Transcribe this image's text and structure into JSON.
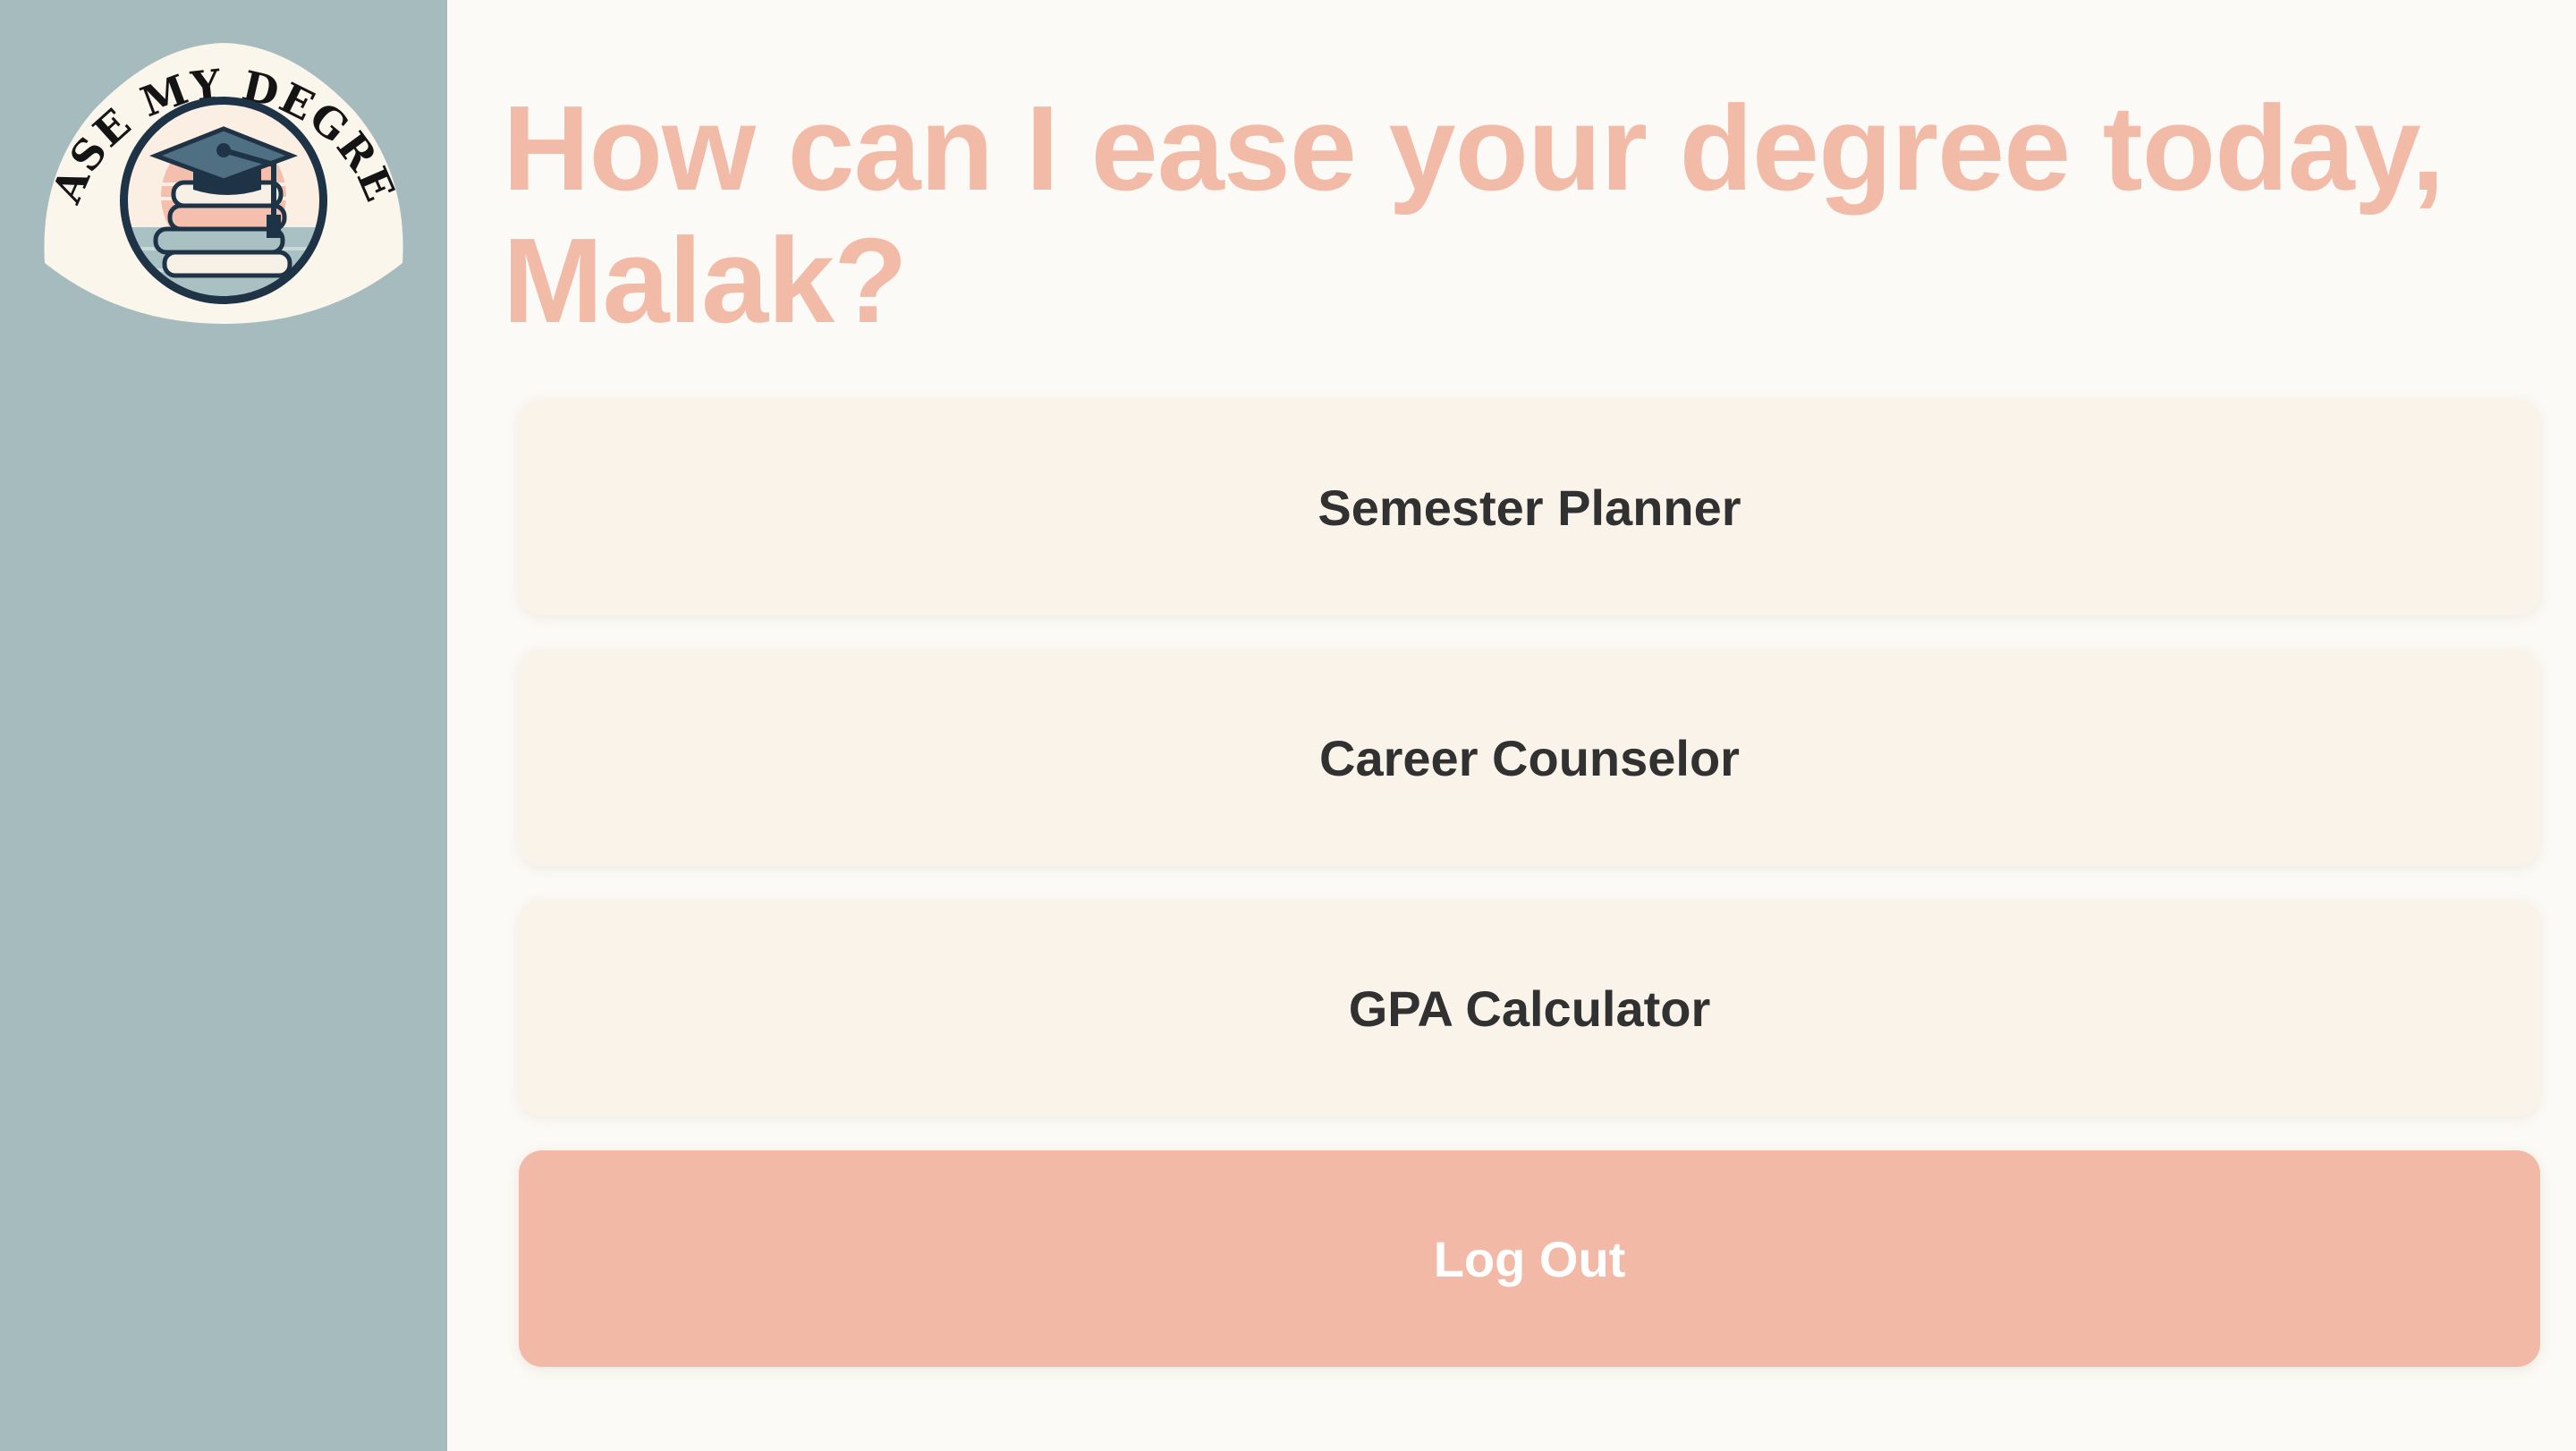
{
  "brand": {
    "logo_text": "EASE MY DEGREE",
    "logo_icon": "graduation-cap-books-icon",
    "colors": {
      "sidebar": "#a6bbbe",
      "accent": "#f2bba8",
      "navy": "#1f3347",
      "background": "#fcfaf6"
    }
  },
  "header": {
    "title": "How can I ease your degree today, Malak?"
  },
  "menu": {
    "items": [
      {
        "label": "Semester Planner"
      },
      {
        "label": "Career Counselor"
      },
      {
        "label": "GPA Calculator"
      }
    ],
    "logout_label": "Log Out"
  }
}
